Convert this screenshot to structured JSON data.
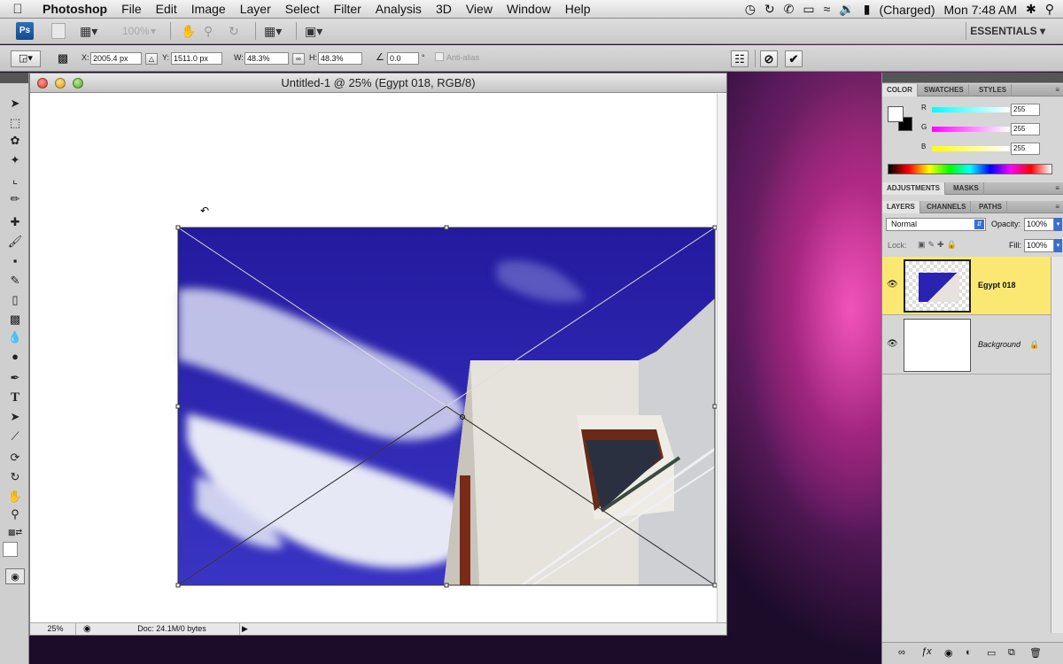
{
  "menubar": {
    "app": "Photoshop",
    "items": [
      "File",
      "Edit",
      "Image",
      "Layer",
      "Select",
      "Filter",
      "Analysis",
      "3D",
      "View",
      "Window",
      "Help"
    ],
    "battery": "(Charged)",
    "clock": "Mon 7:48 AM"
  },
  "appbar": {
    "logo": "Ps",
    "zoom": "100%",
    "workspace": "ESSENTIALS"
  },
  "options": {
    "x_label": "X:",
    "x_value": "2005.4 px",
    "y_label": "Y:",
    "y_value": "1511.0 px",
    "w_label": "W:",
    "w_value": "48.3%",
    "h_label": "H:",
    "h_value": "48.3%",
    "angle_value": "0.0",
    "angle_unit": "°",
    "antialias_label": "Anti-alias"
  },
  "document": {
    "title": "Untitled-1 @ 25% (Egypt 018, RGB/8)",
    "zoom": "25%",
    "doc_info": "Doc: 24.1M/0 bytes"
  },
  "color_panel": {
    "tabs": [
      "COLOR",
      "SWATCHES",
      "STYLES"
    ],
    "r_label": "R",
    "r_value": "255",
    "g_label": "G",
    "g_value": "255",
    "b_label": "B",
    "b_value": "255"
  },
  "adjust_panel": {
    "tabs": [
      "ADJUSTMENTS",
      "MASKS"
    ]
  },
  "layers_panel": {
    "tabs": [
      "LAYERS",
      "CHANNELS",
      "PATHS"
    ],
    "blend_mode": "Normal",
    "opacity_label": "Opacity:",
    "opacity_value": "100%",
    "lock_label": "Lock:",
    "fill_label": "Fill:",
    "fill_value": "100%",
    "layers": [
      {
        "name": "Egypt 018"
      },
      {
        "name": "Background"
      }
    ]
  },
  "colors": {
    "selected_layer": "#fbe873",
    "sky": "#2a22b0"
  }
}
